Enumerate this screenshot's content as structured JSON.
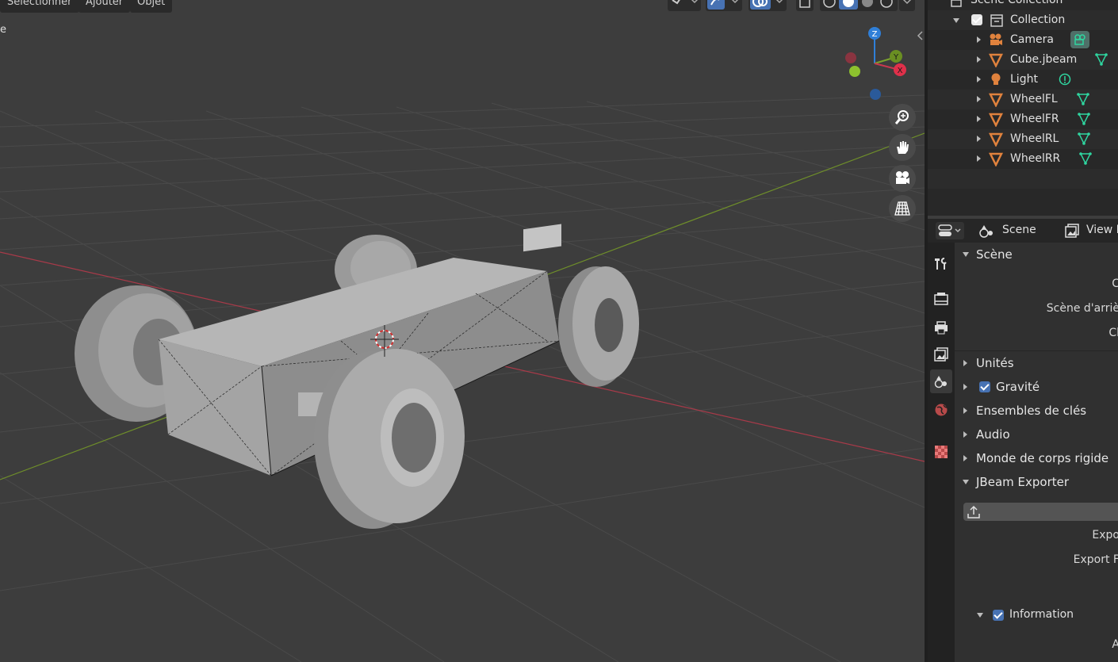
{
  "header": {
    "menus": [
      "Sélectionner",
      "Ajouter",
      "Objet"
    ],
    "mode_label": "e"
  },
  "gizmo": {
    "x_axis": "X",
    "y_axis": "Y",
    "z_axis": "Z"
  },
  "outliner": {
    "scene_collection": "Scene Collection",
    "collection": "Collection",
    "items": [
      {
        "name": "Camera",
        "icon": "camera-icon",
        "data_icon": "camera-data-icon"
      },
      {
        "name": "Cube.jbeam",
        "icon": "mesh-icon",
        "data_icon": "mesh-data-icon"
      },
      {
        "name": "Light",
        "icon": "light-icon",
        "data_icon": "light-data-icon"
      },
      {
        "name": "WheelFL",
        "icon": "mesh-icon",
        "data_icon": "mesh-data-icon"
      },
      {
        "name": "WheelFR",
        "icon": "mesh-icon",
        "data_icon": "mesh-data-icon"
      },
      {
        "name": "WheelRL",
        "icon": "mesh-icon",
        "data_icon": "mesh-data-icon"
      },
      {
        "name": "WheelRR",
        "icon": "mesh-icon",
        "data_icon": "mesh-data-icon"
      }
    ]
  },
  "properties": {
    "header": {
      "scene_tab": "Scene",
      "view_layer_tab": "View L"
    },
    "scene_panel": {
      "title": "Scène",
      "camera_label": "C",
      "background_scene_label": "Scène d'arriè",
      "active_clip_label": "Cl"
    },
    "panels": {
      "units": "Unités",
      "gravity": "Gravité",
      "keying_sets": "Ensembles de clés",
      "audio": "Audio",
      "rigid_body_world": "Monde de corps rigide",
      "jbeam_exporter": "JBeam Exporter"
    },
    "jbeam": {
      "export_label": "Expo",
      "export_f_label": "Export F",
      "information": "Information",
      "a_label": "A"
    }
  },
  "colors": {
    "accent": "#4772b3",
    "axis_x": "#c8384f",
    "axis_y": "#7aa22c",
    "axis_z": "#2f7fd8",
    "object_orange": "#e0823d",
    "data_green": "#2fd6a0"
  }
}
